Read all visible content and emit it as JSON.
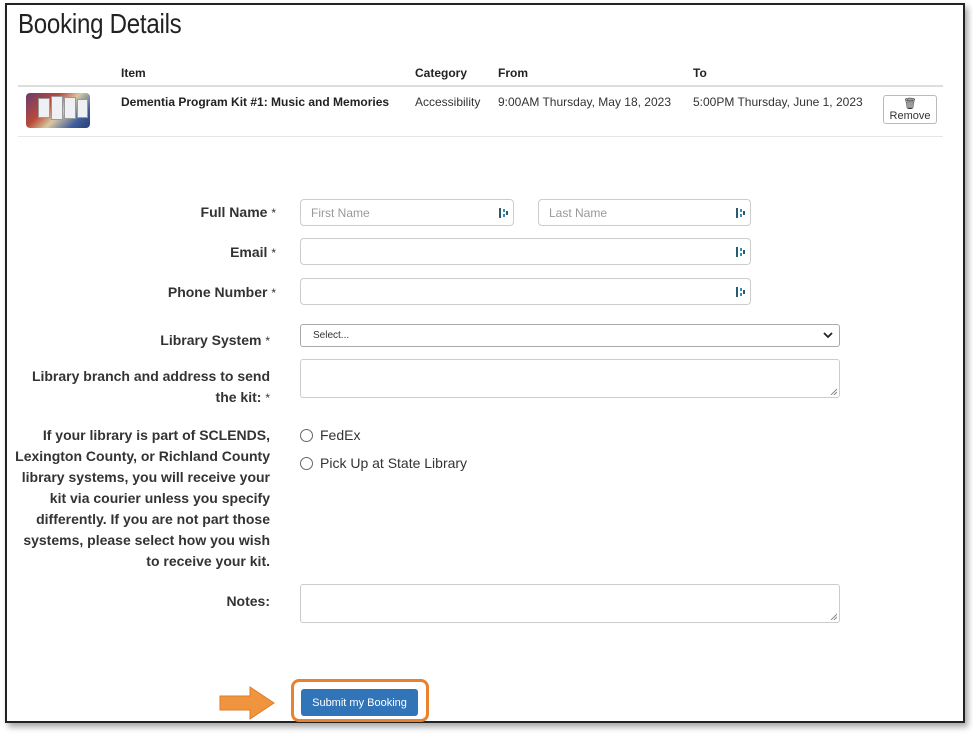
{
  "page": {
    "title": "Booking Details"
  },
  "table": {
    "headers": {
      "item": "Item",
      "category": "Category",
      "from": "From",
      "to": "To"
    },
    "rows": [
      {
        "item": "Dementia Program Kit #1: Music and Memories",
        "category": "Accessibility",
        "from": "9:00AM Thursday, May 18, 2023",
        "to": "5:00PM Thursday, June 1, 2023",
        "remove_label": "Remove",
        "thumb_icon": "kit-photo"
      }
    ]
  },
  "form": {
    "full_name": {
      "label": "Full Name",
      "first_placeholder": "First Name",
      "last_placeholder": "Last Name"
    },
    "email": {
      "label": "Email"
    },
    "phone": {
      "label": "Phone Number"
    },
    "library_system": {
      "label": "Library System",
      "selected": "Select..."
    },
    "branch": {
      "label_line1": "Library branch and address to send",
      "label_line2": "the kit:"
    },
    "delivery": {
      "label_lines": [
        "If your library is part of SCLENDS,",
        "Lexington County, or Richland County",
        "library systems, you will receive your",
        "kit via courier unless you specify",
        "differently. If you are not part those",
        "systems, please select how you wish",
        "to receive your kit."
      ],
      "options": [
        "FedEx",
        "Pick Up at State Library"
      ]
    },
    "notes": {
      "label": "Notes:"
    },
    "required_mark": "*",
    "submit_label": "Submit my Booking"
  },
  "colors": {
    "accent": "#3174b8",
    "highlight": "#e9822f"
  }
}
